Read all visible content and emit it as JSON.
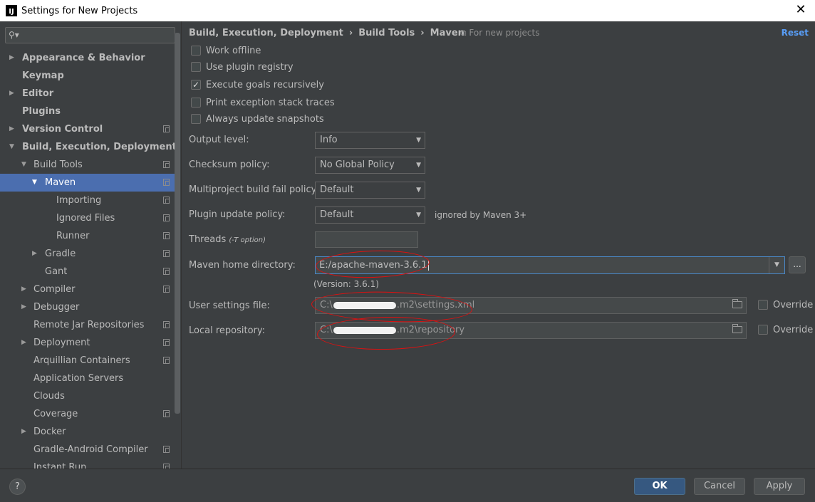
{
  "window": {
    "title": "Settings for New Projects",
    "app_icon": "IJ"
  },
  "sidebar": {
    "search_placeholder": "",
    "items": [
      {
        "label": "Appearance & Behavior",
        "bold": true,
        "level": 0,
        "arrow": "right"
      },
      {
        "label": "Keymap",
        "bold": true,
        "level": 0,
        "arrow": ""
      },
      {
        "label": "Editor",
        "bold": true,
        "level": 0,
        "arrow": "right"
      },
      {
        "label": "Plugins",
        "bold": true,
        "level": 0,
        "arrow": ""
      },
      {
        "label": "Version Control",
        "bold": true,
        "level": 0,
        "arrow": "right",
        "copy": true
      },
      {
        "label": "Build, Execution, Deployment",
        "bold": true,
        "level": 0,
        "arrow": "down"
      },
      {
        "label": "Build Tools",
        "bold": false,
        "level": 1,
        "arrow": "down",
        "copy": true
      },
      {
        "label": "Maven",
        "bold": false,
        "level": 2,
        "arrow": "down",
        "copy": true,
        "selected": true
      },
      {
        "label": "Importing",
        "bold": false,
        "level": 3,
        "arrow": "",
        "copy": true
      },
      {
        "label": "Ignored Files",
        "bold": false,
        "level": 3,
        "arrow": "",
        "copy": true
      },
      {
        "label": "Runner",
        "bold": false,
        "level": 3,
        "arrow": "",
        "copy": true
      },
      {
        "label": "Gradle",
        "bold": false,
        "level": 2,
        "arrow": "right",
        "copy": true
      },
      {
        "label": "Gant",
        "bold": false,
        "level": 2,
        "arrow": "",
        "copy": true
      },
      {
        "label": "Compiler",
        "bold": false,
        "level": 1,
        "arrow": "right",
        "copy": true
      },
      {
        "label": "Debugger",
        "bold": false,
        "level": 1,
        "arrow": "right"
      },
      {
        "label": "Remote Jar Repositories",
        "bold": false,
        "level": 1,
        "arrow": "",
        "copy": true
      },
      {
        "label": "Deployment",
        "bold": false,
        "level": 1,
        "arrow": "right",
        "copy": true
      },
      {
        "label": "Arquillian Containers",
        "bold": false,
        "level": 1,
        "arrow": "",
        "copy": true
      },
      {
        "label": "Application Servers",
        "bold": false,
        "level": 1,
        "arrow": ""
      },
      {
        "label": "Clouds",
        "bold": false,
        "level": 1,
        "arrow": ""
      },
      {
        "label": "Coverage",
        "bold": false,
        "level": 1,
        "arrow": "",
        "copy": true
      },
      {
        "label": "Docker",
        "bold": false,
        "level": 1,
        "arrow": "right"
      },
      {
        "label": "Gradle-Android Compiler",
        "bold": false,
        "level": 1,
        "arrow": "",
        "copy": true
      },
      {
        "label": "Instant Run",
        "bold": false,
        "level": 1,
        "arrow": "",
        "copy": true
      }
    ]
  },
  "header": {
    "breadcrumb": [
      "Build, Execution, Deployment",
      "Build Tools",
      "Maven"
    ],
    "scope_note": "For new projects",
    "reset_label": "Reset"
  },
  "checkboxes": [
    {
      "label": "Work offline",
      "checked": false
    },
    {
      "label": "Use plugin registry",
      "checked": false
    },
    {
      "label": "Execute goals recursively",
      "checked": true
    },
    {
      "label": "Print exception stack traces",
      "checked": false
    },
    {
      "label": "Always update snapshots",
      "checked": false
    }
  ],
  "form": {
    "output_level": {
      "label": "Output level:",
      "value": "Info"
    },
    "checksum_policy": {
      "label": "Checksum policy:",
      "value": "No Global Policy"
    },
    "multiproject_fail": {
      "label": "Multiproject build fail policy:",
      "value": "Default"
    },
    "plugin_update": {
      "label": "Plugin update policy:",
      "value": "Default",
      "note": "ignored by Maven 3+"
    },
    "threads": {
      "label": "Threads",
      "hint": "(-T option)",
      "value": ""
    },
    "maven_home": {
      "label": "Maven home directory:",
      "value": "E:/apache-maven-3.6.1",
      "version": "(Version: 3.6.1)",
      "browse_label": "..."
    },
    "user_settings": {
      "label": "User settings file:",
      "prefix": "C:\\",
      "suffix": ".m2\\settings.xml",
      "override_label": "Override"
    },
    "local_repo": {
      "label": "Local repository:",
      "prefix": "C:\\",
      "suffix": ".m2\\repository",
      "override_label": "Override"
    }
  },
  "footer": {
    "help_label": "?",
    "ok_label": "OK",
    "cancel_label": "Cancel",
    "apply_label": "Apply"
  },
  "colors": {
    "accent": "#4b6eaf",
    "link": "#589df6",
    "annotation": "#e01010"
  }
}
